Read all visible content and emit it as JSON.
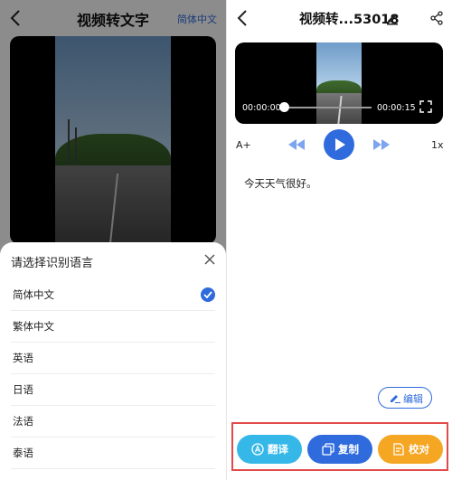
{
  "left_panel": {
    "header": {
      "title": "视频转文字",
      "language_link": "简体中文"
    },
    "sheet": {
      "title": "请选择识别语言",
      "options": [
        {
          "label": "简体中文",
          "selected": true
        },
        {
          "label": "繁体中文",
          "selected": false
        },
        {
          "label": "英语",
          "selected": false
        },
        {
          "label": "日语",
          "selected": false
        },
        {
          "label": "法语",
          "selected": false
        },
        {
          "label": "泰语",
          "selected": false
        }
      ]
    }
  },
  "right_panel": {
    "header": {
      "title": "视频转...53018"
    },
    "player": {
      "current_time": "00:00:00",
      "total_time": "00:00:15",
      "progress": 0.0
    },
    "controls": {
      "font_size_label": "A+",
      "speed_label": "1x"
    },
    "transcript_text": "今天天气很好。",
    "edit_button_label": "编辑",
    "actions": [
      {
        "label": "翻译",
        "color": "#35b8e8"
      },
      {
        "label": "复制",
        "color": "#2f6bdc"
      },
      {
        "label": "校对",
        "color": "#f5a623"
      }
    ]
  },
  "colors": {
    "accent": "#2f6bdc",
    "highlight_border": "#e24b4b"
  }
}
